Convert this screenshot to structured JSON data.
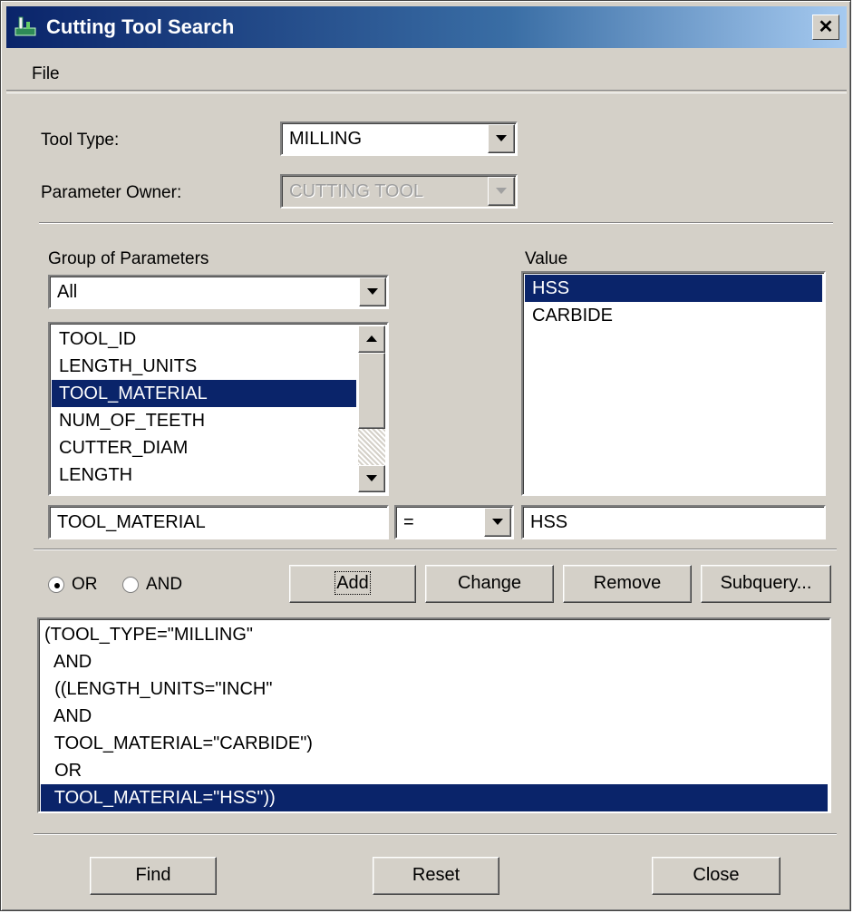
{
  "window": {
    "title": "Cutting Tool Search",
    "close_glyph": "✕"
  },
  "menu": {
    "file": "File"
  },
  "tool_type": {
    "label": "Tool Type:",
    "value": "MILLING"
  },
  "parameter_owner": {
    "label": "Parameter Owner:",
    "value": "CUTTING TOOL"
  },
  "group": {
    "label": "Group of Parameters",
    "value": "All"
  },
  "parameters": {
    "items": [
      "TOOL_ID",
      "LENGTH_UNITS",
      "TOOL_MATERIAL",
      "NUM_OF_TEETH",
      "CUTTER_DIAM",
      "LENGTH"
    ],
    "selected": "TOOL_MATERIAL"
  },
  "value_list": {
    "label": "Value",
    "items": [
      "HSS",
      "CARBIDE"
    ],
    "selected": "HSS"
  },
  "condition": {
    "parameter": "TOOL_MATERIAL",
    "operator": "=",
    "value": "HSS"
  },
  "logic": {
    "or_label": "OR",
    "and_label": "AND",
    "selected": "OR"
  },
  "buttons": {
    "add": "Add",
    "change": "Change",
    "remove": "Remove",
    "subquery": "Subquery..."
  },
  "query": {
    "lines": [
      "(TOOL_TYPE=\"MILLING\"",
      "  AND",
      "  ((LENGTH_UNITS=\"INCH\"",
      "  AND",
      "  TOOL_MATERIAL=\"CARBIDE\")",
      "  OR",
      "  TOOL_MATERIAL=\"HSS\"))"
    ],
    "selected_line": "  TOOL_MATERIAL=\"HSS\"))"
  },
  "footer": {
    "find": "Find",
    "reset": "Reset",
    "close": "Close"
  },
  "colors": {
    "selection": "#0a246a",
    "face": "#d4d0c8",
    "title_start": "#0a246a",
    "title_end": "#a6caf0"
  }
}
